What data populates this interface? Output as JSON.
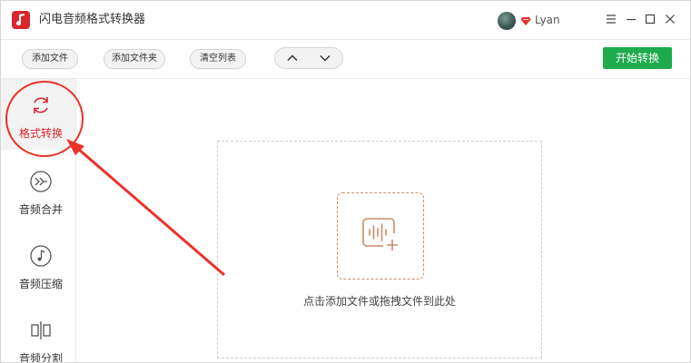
{
  "window": {
    "title": "闪电音频格式转换器",
    "username": "Lyan"
  },
  "toolbar": {
    "add_file": "添加文件",
    "add_folder": "添加文件夹",
    "clear_list": "清空列表",
    "start_convert": "开始转换"
  },
  "sidebar": {
    "items": [
      {
        "label": "格式转换",
        "icon": "refresh-icon",
        "active": true
      },
      {
        "label": "音频合并",
        "icon": "merge-icon",
        "active": false
      },
      {
        "label": "音频压缩",
        "icon": "music-note-icon",
        "active": false
      },
      {
        "label": "音频分割",
        "icon": "split-icon",
        "active": false
      }
    ]
  },
  "main": {
    "drop_hint": "点击添加文件或拖拽文件到此处"
  },
  "colors": {
    "accent_red": "#d9272e",
    "start_green": "#1eab4d",
    "annotation_red": "#e8332b",
    "drop_icon": "#c98b6b"
  }
}
